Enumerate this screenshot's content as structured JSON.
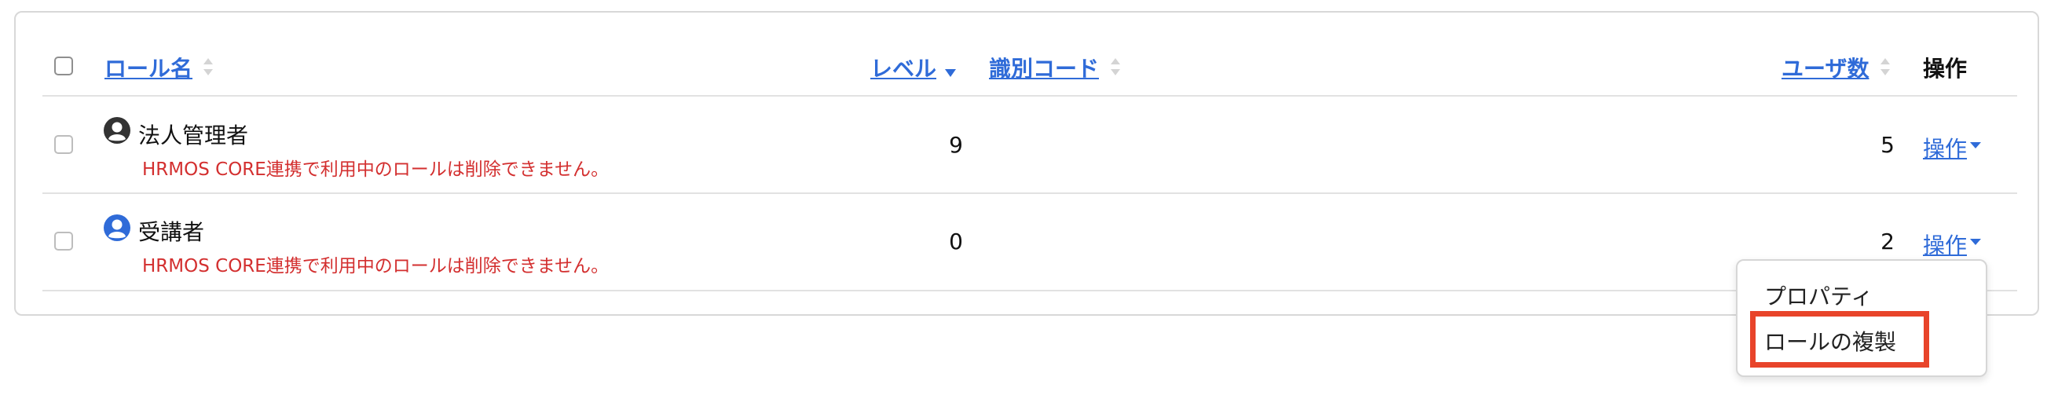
{
  "table": {
    "headers": {
      "role_name": "ロール名",
      "level": "レベル",
      "code": "識別コード",
      "users": "ユーザ数",
      "actions": "操作"
    },
    "rows": [
      {
        "name": "法人管理者",
        "warning": "HRMOS CORE連携で利用中のロールは削除できません。",
        "level": "9",
        "users": "5",
        "action_label": "操作",
        "icon": "user-circle-icon",
        "icon_color": "#333333"
      },
      {
        "name": "受講者",
        "warning": "HRMOS CORE連携で利用中のロールは削除できません。",
        "level": "0",
        "users": "2",
        "action_label": "操作",
        "icon": "user-circle-icon",
        "icon_color": "#2f6bd8"
      }
    ]
  },
  "dropdown": {
    "items": [
      "プロパティ",
      "ロールの複製"
    ],
    "highlight_color": "#e8442a"
  },
  "colors": {
    "link": "#2f6bd8",
    "warning": "#d32f2f"
  }
}
